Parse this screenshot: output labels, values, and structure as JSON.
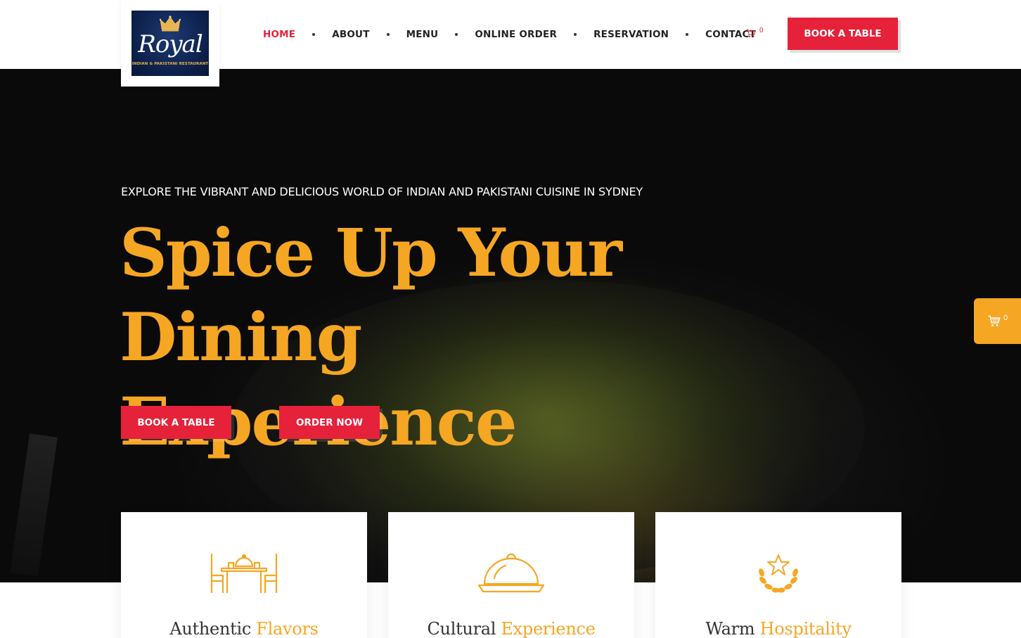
{
  "logo": {
    "title": "Royal",
    "subtitle": "INDIAN & PAKISTANI RESTAURANT",
    "icon": "crown-icon"
  },
  "nav": {
    "items": [
      {
        "label": "HOME",
        "active": true
      },
      {
        "label": "ABOUT",
        "active": false
      },
      {
        "label": "MENU",
        "active": false
      },
      {
        "label": "ONLINE ORDER",
        "active": false
      },
      {
        "label": "RESERVATION",
        "active": false
      },
      {
        "label": "CONTACT",
        "active": false
      }
    ],
    "cart_count": "0",
    "book_button": "BOOK A TABLE"
  },
  "hero": {
    "subtitle": "EXPLORE THE VIBRANT AND DELICIOUS WORLD OF INDIAN AND PAKISTANI CUISINE IN SYDNEY",
    "title_line1": "Spice Up Your Dining",
    "title_line2": "Experience",
    "book_button": "BOOK A TABLE",
    "order_button": "ORDER NOW"
  },
  "floating_cart": {
    "count": "0",
    "icon": "cart-icon"
  },
  "features": [
    {
      "title_plain": "Authentic ",
      "title_highlight": "Flavors",
      "icon": "dining-table-icon"
    },
    {
      "title_plain": "Cultural ",
      "title_highlight": "Experience",
      "icon": "cloche-icon"
    },
    {
      "title_plain": "Warm ",
      "title_highlight": "Hospitality",
      "icon": "star-laurel-icon"
    }
  ],
  "colors": {
    "accent_red": "#e5223a",
    "accent_gold": "#f5a623",
    "logo_navy": "#0c1f4a"
  }
}
